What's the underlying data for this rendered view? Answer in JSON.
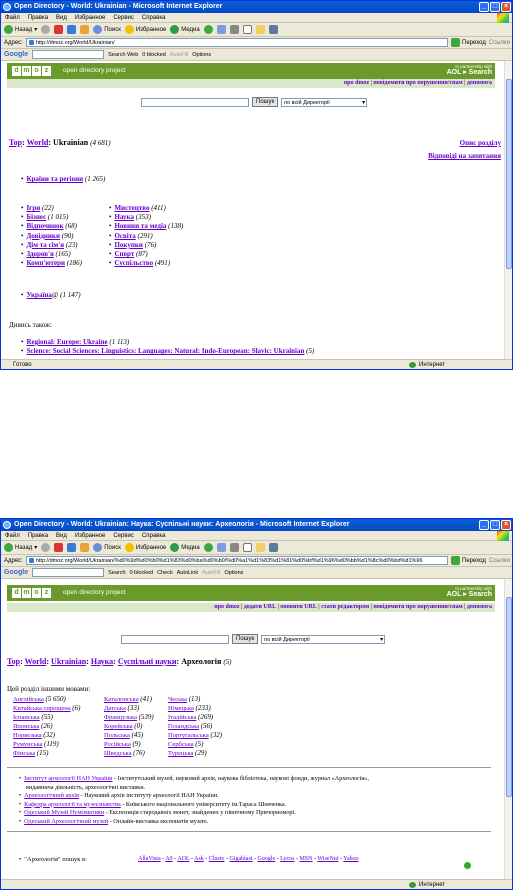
{
  "win1": {
    "title": "Open Directory - World: Ukrainian - Microsoft Internet Explorer",
    "menu": [
      "Файл",
      "Правка",
      "Вид",
      "Избранное",
      "Сервис",
      "Справка"
    ],
    "toolbar": {
      "back": "Назад",
      "search": "Поиск",
      "favorites": "Избранное",
      "media": "Медиа"
    },
    "address_label": "Адрес:",
    "address": "http://dmoz.org/World/Ukrainian/",
    "go": "Переход",
    "links": "Ссылки",
    "google": {
      "logo": "Google",
      "search_web": "Search Web",
      "blocked": "0 blocked",
      "autofill": "AutoFill",
      "options": "Options"
    },
    "dmoz": {
      "logo": [
        "d",
        "m",
        "o",
        "z"
      ],
      "odp": "open directory project",
      "aol_line1": "In partnership with",
      "aol_line2": "AOL ▸ Search"
    },
    "toplinks": [
      "про dmoz",
      "повідомити про порушення/спам",
      "допомога"
    ],
    "search_button": "Пошук",
    "search_scope": "по всій Директорії",
    "breadcrumb": {
      "top": "Top",
      "world": "World",
      "current": "Ukrainian",
      "count": "(4 681)"
    },
    "side_links": [
      "Опис розділу",
      "Відповіді на запитання"
    ],
    "regions": {
      "label": "Країни та регіони",
      "count": "(1 265)"
    },
    "col1": [
      {
        "label": "Ігри",
        "count": "(22)"
      },
      {
        "label": "Бізнес",
        "count": "(1 015)"
      },
      {
        "label": "Відпочинок",
        "count": "(68)"
      },
      {
        "label": "Довідники",
        "count": "(90)"
      },
      {
        "label": "Дім та сім'я",
        "count": "(23)"
      },
      {
        "label": "Здоров'я",
        "count": "(165)"
      },
      {
        "label": "Комп'ютери",
        "count": "(186)"
      }
    ],
    "col2": [
      {
        "label": "Мистецтво",
        "count": "(411)"
      },
      {
        "label": "Наука",
        "count": "(353)"
      },
      {
        "label": "Новини та медіа",
        "count": "(138)"
      },
      {
        "label": "Освіта",
        "count": "(291)"
      },
      {
        "label": "Покупки",
        "count": "(76)"
      },
      {
        "label": "Спорт",
        "count": "(87)"
      },
      {
        "label": "Суспільство",
        "count": "(491)"
      }
    ],
    "ukraine": {
      "label": "Україна",
      "suffix": "@",
      "count": "(1 147)"
    },
    "see_also": "Дивись також:",
    "see_also_items": [
      {
        "label": "Regional: Europe: Ukraine",
        "count": "(1 113)"
      },
      {
        "label": "Science: Social Sciences: Linguistics: Languages: Natural: Indo-European: Slavic: Ukrainian",
        "count": "(5)"
      }
    ],
    "status": "Готово",
    "zone": "Интернет"
  },
  "win2": {
    "title": "Open Directory - World: Ukrainian: Наука: Суспільні науки: Археологія - Microsoft Internet Explorer",
    "menu": [
      "Файл",
      "Правка",
      "Вид",
      "Избранное",
      "Сервис",
      "Справка"
    ],
    "toolbar": {
      "back": "Назад",
      "search": "Поиск",
      "favorites": "Избранное",
      "media": "Медиа"
    },
    "address_label": "Адрес:",
    "address": "http://dmoz.org/World/Ukrainian/%d0%9d%d0%b0%d1%83%d0%ba%d0%b0/%d0%a1%d1%83%d1%81%d0%bf%d1%96%d0%bb%d1%8c%d0%bd%d1%96",
    "go": "Переход",
    "links": "Ссылки",
    "google": {
      "logo": "Google",
      "search": "Search",
      "blocked": "0 blocked",
      "check": "Check",
      "autolink": "AutoLink",
      "autofill": "AutoFill",
      "options": "Options"
    },
    "dmoz": {
      "logo": [
        "d",
        "m",
        "o",
        "z"
      ],
      "odp": "open directory project",
      "aol_line1": "In partnership with",
      "aol_line2": "AOL ▸ Search"
    },
    "toplinks": [
      "про dmoz",
      "додати URL",
      "оновити URL",
      "стати редактором",
      "повідомити про порушення/спам",
      "допомога"
    ],
    "search_button": "Пошук",
    "search_scope": "по всій Директорії",
    "breadcrumb": {
      "top": "Top",
      "world": "World",
      "ukrainian": "Ukrainian",
      "science": "Наука",
      "social": "Суспільні науки",
      "current": "Археологія",
      "count": "(5)"
    },
    "other_langs": "Цей розділ іншими мовами:",
    "lang_col1": [
      {
        "label": "Англійська",
        "count": "(5 650)"
      },
      {
        "label": "Китайська спрощена",
        "count": "(6)"
      },
      {
        "label": "Іспанська",
        "count": "(55)"
      },
      {
        "label": "Японська",
        "count": "(26)"
      },
      {
        "label": "Норвезька",
        "count": "(32)"
      },
      {
        "label": "Румунська",
        "count": "(119)"
      },
      {
        "label": "Фінська",
        "count": "(15)"
      }
    ],
    "lang_col2": [
      {
        "label": "Каталонська",
        "count": "(41)"
      },
      {
        "label": "Датська",
        "count": "(33)"
      },
      {
        "label": "Французька",
        "count": "(539)"
      },
      {
        "label": "Корейська",
        "count": "(0)"
      },
      {
        "label": "Польська",
        "count": "(45)"
      },
      {
        "label": "Російська",
        "count": "(9)"
      },
      {
        "label": "Шведська",
        "count": "(76)"
      }
    ],
    "lang_col3": [
      {
        "label": "Чеська",
        "count": "(13)"
      },
      {
        "label": "Німецька",
        "count": "(233)"
      },
      {
        "label": "Італійська",
        "count": "(269)"
      },
      {
        "label": "Голандська",
        "count": "(56)"
      },
      {
        "label": "Португальська",
        "count": "(32)"
      },
      {
        "label": "Сербська",
        "count": "(5)"
      },
      {
        "label": "Турецька",
        "count": "(29)"
      }
    ],
    "sites": [
      {
        "label": "Інститут археології НАН України",
        "desc": " - Інститутський музей, науковий архів, наукова бібліотека, наукові фонди, журнал «Археологія»,",
        "desc2": "видавнича діяльність, археологічні виставки."
      },
      {
        "label": "Археологічний архів",
        "desc": " - Науковий архів інституту археології НАН України."
      },
      {
        "label": "Кафедра археології та музеєзнавства",
        "desc": " - Київського національного університету ім.Тараса Шевченка."
      },
      {
        "label": "Одеський Музей Нумізматики",
        "desc": " - Експозиція стародавніх монет, знайдених у північному Причорноморї."
      },
      {
        "label": "Одеський Археологічний музей",
        "desc": " - Онлайн-виставка експонатів музею."
      }
    ],
    "search_for_prefix": "\"Археологія\" пошук в:",
    "engines": [
      "AllaVista",
      "A9",
      "AOL",
      "Ask",
      "Clusty",
      "Gigablast",
      "Google",
      "Lycos",
      "MSN",
      "WiseNut",
      "Yahoo"
    ],
    "zone": "Интернет"
  },
  "colors": {
    "titlebar": "#0548c4",
    "dmoz_green": "#6a9a2c",
    "link_purple": "#6600cc"
  }
}
